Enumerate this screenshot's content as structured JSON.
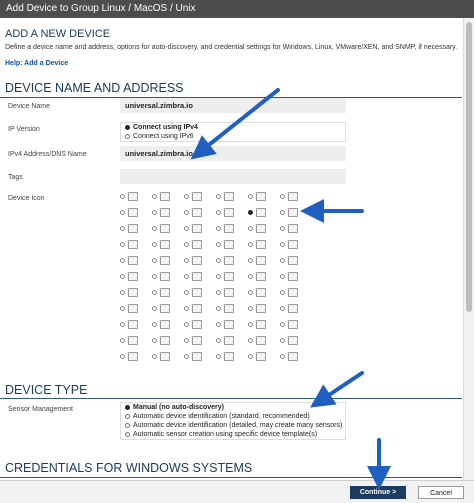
{
  "window": {
    "title": "Add Device to Group Linux / MacOS / Unix"
  },
  "header": {
    "heading": "ADD A NEW DEVICE",
    "intro": "Define a device name and address, options for auto-discovery, and credential settings for Windows, Linux, VMware/XEN, and SNMP, if necessary.",
    "help_link": "Help: Add a Device"
  },
  "device_name_section": {
    "title": "DEVICE NAME AND ADDRESS",
    "device_name_label": "Device Name",
    "device_name_value": "universal.zimbra.io",
    "ip_version_label": "IP Version",
    "ip_options": [
      "Connect using IPv4",
      "Connect using IPv6"
    ],
    "ip_selected": "Connect using IPv4",
    "address_label": "IPv4 Address/DNS Name",
    "address_value": "universal.zimbra.io",
    "tags_label": "Tags",
    "tags_value": "",
    "device_icon_label": "Device Icon",
    "icon_selected_index": 10
  },
  "device_type_section": {
    "title": "DEVICE TYPE",
    "sensor_label": "Sensor Management",
    "options": [
      "Manual (no auto-discovery)",
      "Automatic device identification (standard, recommended)",
      "Automatic device identification (detailed, may create many sensors)",
      "Automatic sensor creation using specific device template(s)"
    ],
    "selected": "Manual (no auto-discovery)"
  },
  "credentials_section": {
    "title": "CREDENTIALS FOR WINDOWS SYSTEMS"
  },
  "footer": {
    "continue_label": "Continue >",
    "cancel_label": "Cancel"
  },
  "colors": {
    "titlebar": "#4d4d4d",
    "section_text": "#1a3a5c",
    "primary_button": "#1d3b5e",
    "annotation_arrow": "#1f5fbf"
  }
}
